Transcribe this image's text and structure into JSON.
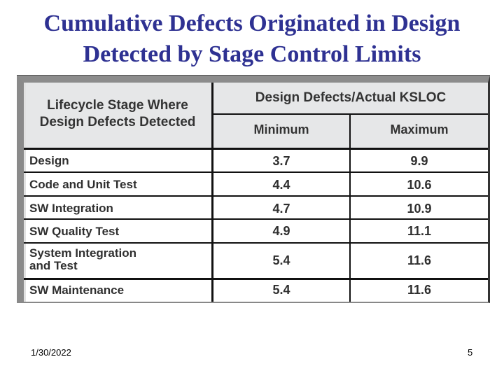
{
  "slide": {
    "title_line1": "Cumulative Defects Originated in Design",
    "title_line2": "Detected by Stage Control Limits",
    "title_color": "#2e3192"
  },
  "table": {
    "header": {
      "stage_col_line1": "Lifecycle Stage Where",
      "stage_col_line2": "Design Defects Detected",
      "group_header": "Design Defects/Actual KSLOC",
      "min_label": "Minimum",
      "max_label": "Maximum"
    },
    "rows": [
      {
        "stage_line1": "Design",
        "stage_line2": "",
        "min": "3.7",
        "max": "9.9"
      },
      {
        "stage_line1": "Code and Unit Test",
        "stage_line2": "",
        "min": "4.4",
        "max": "10.6"
      },
      {
        "stage_line1": "SW Integration",
        "stage_line2": "",
        "min": "4.7",
        "max": "10.9"
      },
      {
        "stage_line1": "SW Quality Test",
        "stage_line2": "",
        "min": "4.9",
        "max": "11.1"
      },
      {
        "stage_line1": "System Integration",
        "stage_line2": "and Test",
        "min": "5.4",
        "max": "11.6"
      },
      {
        "stage_line1": "SW Maintenance",
        "stage_line2": "",
        "min": "5.4",
        "max": "11.6"
      }
    ]
  },
  "footer": {
    "date": "1/30/2022",
    "page_number": "5"
  }
}
